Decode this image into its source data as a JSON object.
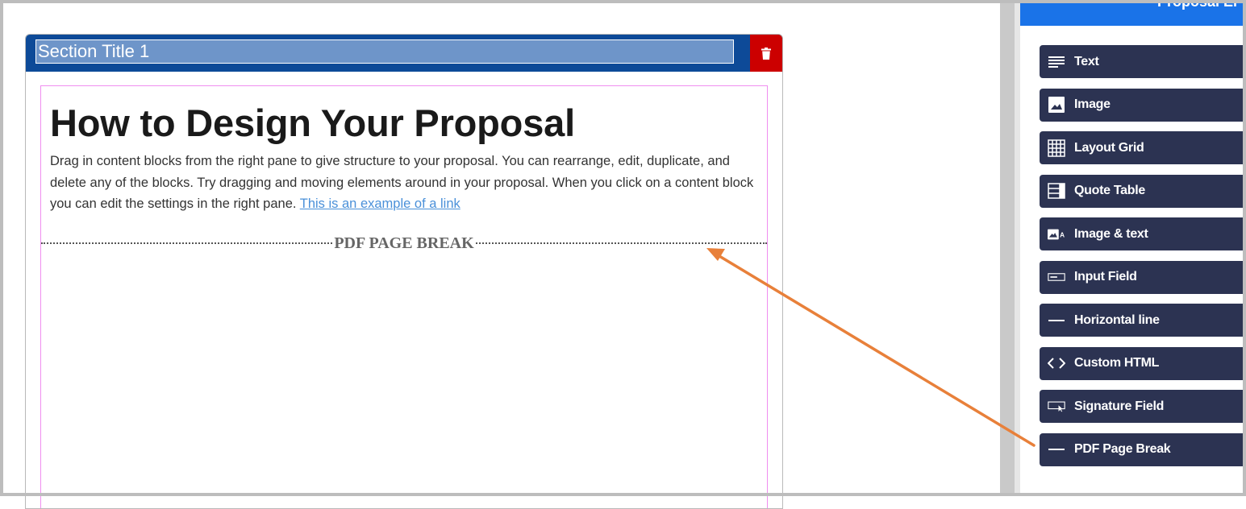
{
  "section": {
    "title_value": "Section Title 1"
  },
  "content": {
    "heading": "How to Design Your Proposal",
    "paragraph": "Drag in content blocks from the right pane to give structure to your proposal. You can rearrange, edit, duplicate, and delete any of the blocks. Try dragging and moving elements around in your proposal. When you click on a content block you can edit the settings in the right pane. ",
    "link_text": "This is an example of a link",
    "page_break_label": "PDF PAGE BREAK"
  },
  "panel": {
    "header_title": "Proposal El",
    "blocks": [
      {
        "label": "Text",
        "icon": "text-lines-icon"
      },
      {
        "label": "Image",
        "icon": "image-icon"
      },
      {
        "label": "Layout Grid",
        "icon": "grid-icon"
      },
      {
        "label": "Quote Table",
        "icon": "table-icon"
      },
      {
        "label": "Image & text",
        "icon": "image-text-icon"
      },
      {
        "label": "Input Field",
        "icon": "input-field-icon"
      },
      {
        "label": "Horizontal line",
        "icon": "horizontal-line-icon"
      },
      {
        "label": "Custom HTML",
        "icon": "code-icon"
      },
      {
        "label": "Signature Field",
        "icon": "signature-icon"
      },
      {
        "label": "PDF Page Break",
        "icon": "page-break-icon"
      }
    ]
  },
  "colors": {
    "section_header": "#0d4a98",
    "delete_button": "#cc0000",
    "block_button": "#2c3352",
    "panel_header": "#1a73e8",
    "annotation_arrow": "#e8803a",
    "content_border": "#f08ef0"
  }
}
